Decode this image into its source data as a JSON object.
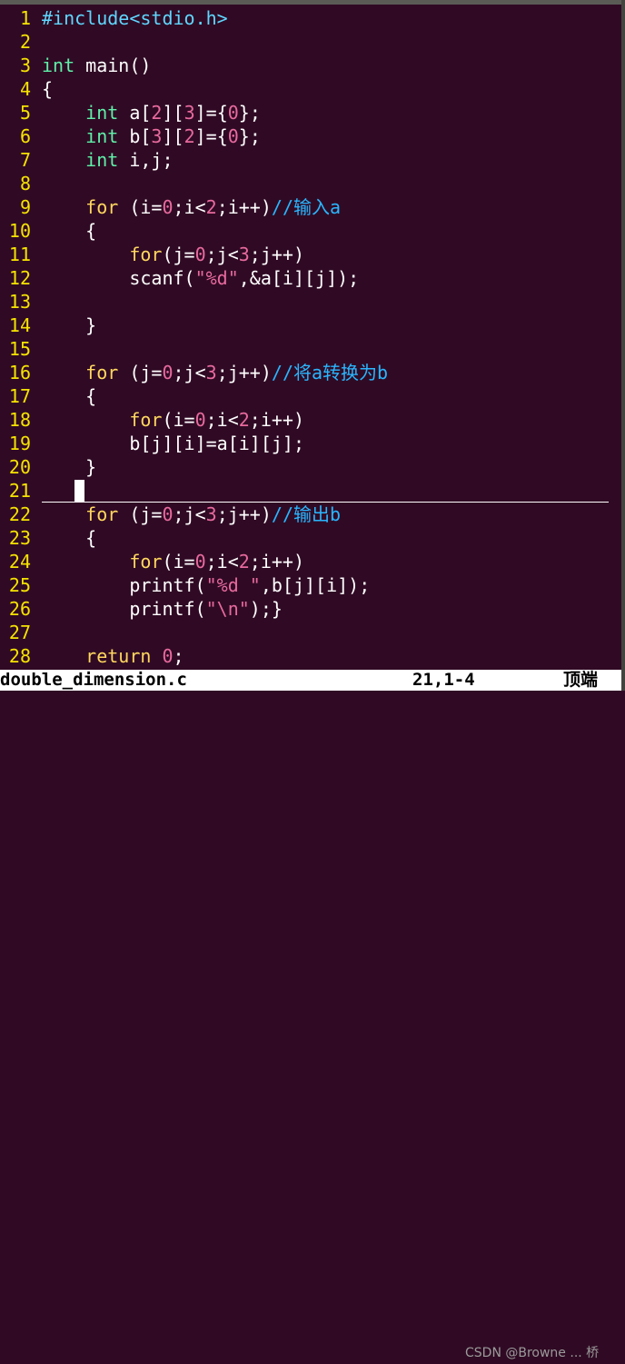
{
  "editor": {
    "filename": "double_dimension.c",
    "position": "21,1-4",
    "scroll": "顶端",
    "watermark": "CSDN @Browne ... 桥",
    "lines": [
      {
        "n": "1",
        "t": "#include<stdio.h>"
      },
      {
        "n": "2",
        "t": ""
      },
      {
        "n": "3",
        "t": "int main()"
      },
      {
        "n": "4",
        "t": "{"
      },
      {
        "n": "5",
        "t": "    int a[2][3]={0};"
      },
      {
        "n": "6",
        "t": "    int b[3][2]={0};"
      },
      {
        "n": "7",
        "t": "    int i,j;"
      },
      {
        "n": "8",
        "t": ""
      },
      {
        "n": "9",
        "t": "    for (i=0;i<2;i++)//输入a"
      },
      {
        "n": "10",
        "t": "    {"
      },
      {
        "n": "11",
        "t": "        for(j=0;j<3;j++)"
      },
      {
        "n": "12",
        "t": "        scanf(\"%d\",&a[i][j]);"
      },
      {
        "n": "13",
        "t": ""
      },
      {
        "n": "14",
        "t": "    }"
      },
      {
        "n": "15",
        "t": ""
      },
      {
        "n": "16",
        "t": "    for (j=0;j<3;j++)//将a转换为b"
      },
      {
        "n": "17",
        "t": "    {"
      },
      {
        "n": "18",
        "t": "        for(i=0;i<2;i++)"
      },
      {
        "n": "19",
        "t": "        b[j][i]=a[i][j];"
      },
      {
        "n": "20",
        "t": "    }"
      },
      {
        "n": "21",
        "t": ""
      },
      {
        "n": "22",
        "t": "    for (j=0;j<3;j++)//输出b"
      },
      {
        "n": "23",
        "t": "    {"
      },
      {
        "n": "24",
        "t": "        for(i=0;i<2;i++)"
      },
      {
        "n": "25",
        "t": "        printf(\"%d \",b[j][i]);"
      },
      {
        "n": "26",
        "t": "        printf(\"\\n\");}"
      },
      {
        "n": "27",
        "t": ""
      },
      {
        "n": "28",
        "t": "    return 0;"
      }
    ]
  }
}
